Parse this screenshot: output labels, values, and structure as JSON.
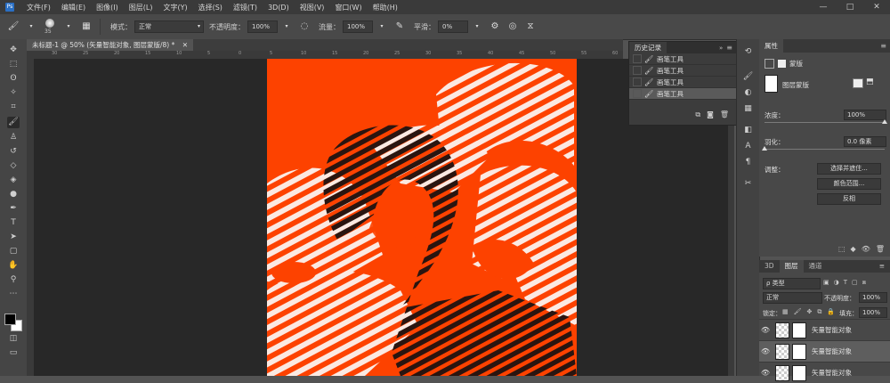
{
  "app": {
    "logo": "Ps"
  },
  "menu": [
    "文件(F)",
    "编辑(E)",
    "图像(I)",
    "图层(L)",
    "文字(Y)",
    "选择(S)",
    "滤镜(T)",
    "3D(D)",
    "视图(V)",
    "窗口(W)",
    "帮助(H)"
  ],
  "window_controls": {
    "min": "—",
    "max": "□",
    "close": "✕"
  },
  "options": {
    "brush_size": "35",
    "mode_label": "模式：",
    "mode_value": "正常",
    "opacity_label": "不透明度：",
    "opacity_value": "100%",
    "flow_label": "流量：",
    "flow_value": "100%",
    "smooth_label": "平滑：",
    "smooth_value": "0%"
  },
  "document_tab": {
    "title": "未标题-1 @ 50% (矢量智能对象, 图层蒙版/8) *",
    "close": "✕"
  },
  "ruler_top_labels": [
    "30",
    "25",
    "20",
    "15",
    "10",
    "5",
    "0",
    "5",
    "10",
    "15",
    "20",
    "25",
    "30",
    "35",
    "40",
    "45",
    "50",
    "55",
    "60"
  ],
  "history": {
    "title": "历史记录",
    "items": [
      {
        "label": "画笔工具",
        "selected": false
      },
      {
        "label": "画笔工具",
        "selected": false
      },
      {
        "label": "画笔工具",
        "selected": false
      },
      {
        "label": "画笔工具",
        "selected": true
      }
    ]
  },
  "properties": {
    "title": "属性",
    "mask_label": "蒙版",
    "layer_mask_label": "图层蒙版",
    "density_label": "浓度：",
    "density_value": "100%",
    "density_level": 1.0,
    "feather_label": "羽化：",
    "feather_value": "0.0 像素",
    "feather_level": 0.0,
    "adjust_label": "调整：",
    "btn_select_mask": "选择并遮住...",
    "btn_color_range": "颜色范围...",
    "btn_invert": "反相"
  },
  "layers": {
    "tabs": [
      "3D",
      "图层",
      "通道"
    ],
    "active_tab": "图层",
    "filter_type": "ρ 类型",
    "blend_mode": "正常",
    "opacity_label": "不透明度：",
    "opacity_value": "100%",
    "lock_label": "锁定：",
    "fill_label": "填充：",
    "fill_value": "100%",
    "items": [
      {
        "name": "矢量智能对象",
        "selected": false
      },
      {
        "name": "矢量智能对象",
        "selected": true
      },
      {
        "name": "矢量智能对象",
        "selected": false
      }
    ]
  },
  "colors": {
    "artboard": "#fd4200",
    "stripe_light": "#fbe9e2",
    "stripe_dark": "#2a1510"
  }
}
